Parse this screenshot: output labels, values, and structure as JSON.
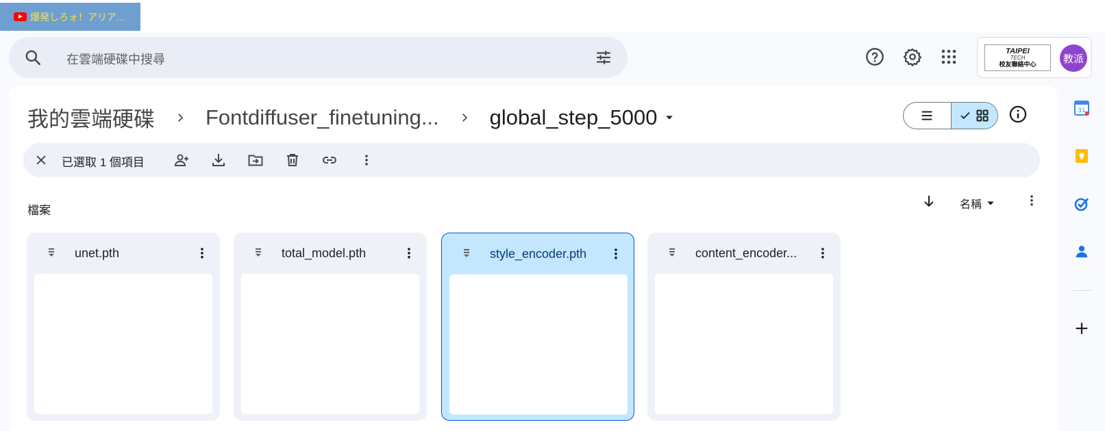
{
  "browser_tab": {
    "title": "爆発しろォ！アリア..."
  },
  "search": {
    "placeholder": "在雲端硬碟中搜尋"
  },
  "account": {
    "logo_line1": "TAIPEI",
    "logo_line2": "TECH",
    "logo_line3": "校友聯絡中心",
    "avatar_text": "教派",
    "avatar_color": "#8e44ce"
  },
  "breadcrumb": {
    "items": [
      "我的雲端硬碟",
      "Fontdiffuser_finetuning..."
    ],
    "current": "global_step_5000"
  },
  "selection_bar": {
    "text": "已選取 1 個項目"
  },
  "section": {
    "label": "檔案"
  },
  "sort": {
    "label": "名稱"
  },
  "files": [
    {
      "name": "unet.pth",
      "selected": false
    },
    {
      "name": "total_model.pth",
      "selected": false
    },
    {
      "name": "style_encoder.pth",
      "selected": true
    },
    {
      "name": "content_encoder...",
      "selected": false
    }
  ],
  "colors": {
    "accent": "#0b57d0",
    "selected_bg": "#c2e7ff",
    "surface": "#eef2f8"
  }
}
